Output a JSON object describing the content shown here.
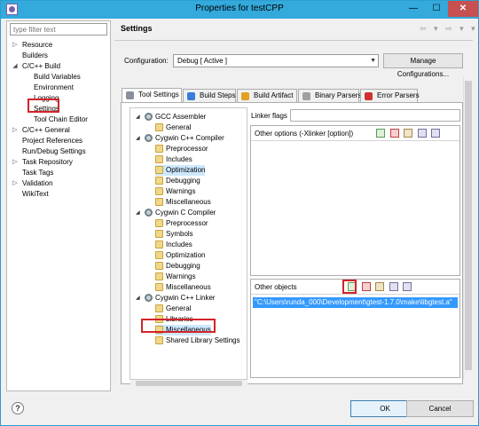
{
  "window": {
    "title": "Properties for testCPP",
    "close_glyph": "✕",
    "min_glyph": "—",
    "max_glyph": "☐"
  },
  "filter": {
    "placeholder": "type filter text"
  },
  "nav": [
    {
      "label": "Resource",
      "arrow": "▷"
    },
    {
      "label": "Builders",
      "arrow": ""
    },
    {
      "label": "C/C++ Build",
      "arrow": "◢"
    },
    {
      "label": "Build Variables",
      "arrow": ""
    },
    {
      "label": "Environment",
      "arrow": ""
    },
    {
      "label": "Logging",
      "arrow": ""
    },
    {
      "label": "Settings",
      "arrow": ""
    },
    {
      "label": "Tool Chain Editor",
      "arrow": ""
    },
    {
      "label": "C/C++ General",
      "arrow": "▷"
    },
    {
      "label": "Project References",
      "arrow": ""
    },
    {
      "label": "Run/Debug Settings",
      "arrow": ""
    },
    {
      "label": "Task Repository",
      "arrow": "▷"
    },
    {
      "label": "Task Tags",
      "arrow": ""
    },
    {
      "label": "Validation",
      "arrow": "▷"
    },
    {
      "label": "WikiText",
      "arrow": ""
    }
  ],
  "header": {
    "title": "Settings",
    "arrows": "⇦ ▾ ⇨ ▾ ▾"
  },
  "configuration": {
    "label": "Configuration:",
    "value": "Debug  [ Active ]",
    "manage_label": "Manage Configurations..."
  },
  "tabs": [
    {
      "label": "Tool Settings",
      "color": "#8a8fa0"
    },
    {
      "label": "Build Steps",
      "color": "#3a7bd5"
    },
    {
      "label": "Build Artifact",
      "color": "#e0a020"
    },
    {
      "label": "Binary Parsers",
      "color": "#a0a0a0"
    },
    {
      "label": "Error Parsers",
      "color": "#d03030"
    }
  ],
  "tree": [
    {
      "label": "GCC Assembler",
      "arrow": "◢",
      "icon": "gear"
    },
    {
      "label": "General",
      "arrow": "",
      "icon": "folder"
    },
    {
      "label": "Cygwin C++ Compiler",
      "arrow": "◢",
      "icon": "gear"
    },
    {
      "label": "Preprocessor",
      "arrow": "",
      "icon": "folder"
    },
    {
      "label": "Includes",
      "arrow": "",
      "icon": "folder"
    },
    {
      "label": "Optimization",
      "arrow": "",
      "icon": "folder"
    },
    {
      "label": "Debugging",
      "arrow": "",
      "icon": "folder"
    },
    {
      "label": "Warnings",
      "arrow": "",
      "icon": "folder"
    },
    {
      "label": "Miscellaneous",
      "arrow": "",
      "icon": "folder"
    },
    {
      "label": "Cygwin C Compiler",
      "arrow": "◢",
      "icon": "gear"
    },
    {
      "label": "Preprocessor",
      "arrow": "",
      "icon": "folder"
    },
    {
      "label": "Symbols",
      "arrow": "",
      "icon": "folder"
    },
    {
      "label": "Includes",
      "arrow": "",
      "icon": "folder"
    },
    {
      "label": "Optimization",
      "arrow": "",
      "icon": "folder"
    },
    {
      "label": "Debugging",
      "arrow": "",
      "icon": "folder"
    },
    {
      "label": "Warnings",
      "arrow": "",
      "icon": "folder"
    },
    {
      "label": "Miscellaneous",
      "arrow": "",
      "icon": "folder"
    },
    {
      "label": "Cygwin C++ Linker",
      "arrow": "◢",
      "icon": "gear"
    },
    {
      "label": "General",
      "arrow": "",
      "icon": "folder"
    },
    {
      "label": "Libraries",
      "arrow": "",
      "icon": "folder"
    },
    {
      "label": "Miscellaneous",
      "arrow": "",
      "icon": "folder"
    },
    {
      "label": "Shared Library Settings",
      "arrow": "",
      "icon": "folder"
    }
  ],
  "options": {
    "linker_flags_label": "Linker flags",
    "linker_flags_value": "",
    "other_options_label": "Other options (-Xlinker [option])",
    "other_options_items": [],
    "other_objects_label": "Other objects",
    "other_objects_items": [
      "\"C:\\Users\\runda_000\\Development\\gtest-1.7.0\\make\\libgtest.a\""
    ]
  },
  "buttons": {
    "help": "?",
    "ok": "OK",
    "cancel": "Cancel"
  },
  "highlight_color": "#d2232a"
}
